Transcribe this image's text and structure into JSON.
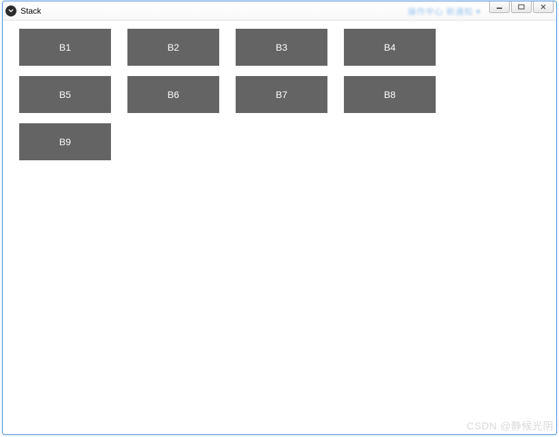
{
  "window": {
    "title": "Stack"
  },
  "blur_hint": "操作中心  新通知 ▾",
  "buttons": {
    "items": [
      {
        "label": "B1"
      },
      {
        "label": "B2"
      },
      {
        "label": "B3"
      },
      {
        "label": "B4"
      },
      {
        "label": "B5"
      },
      {
        "label": "B6"
      },
      {
        "label": "B7"
      },
      {
        "label": "B8"
      },
      {
        "label": "B9"
      }
    ]
  },
  "watermark": "CSDN @静候光阴"
}
